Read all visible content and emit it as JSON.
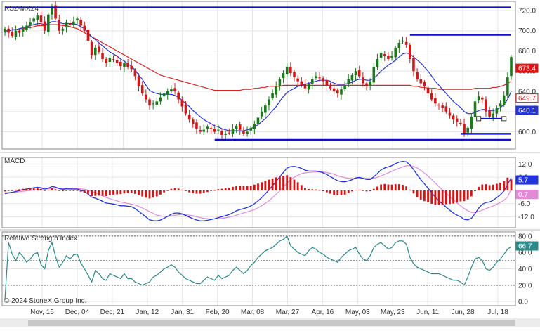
{
  "panels": {
    "price_title": "RS2-MX24",
    "macd_title": "MACD",
    "rsi_title": "Relative Strength Index",
    "copyright": "© 2024 StoneX Group Inc."
  },
  "colors": {
    "candle_up": "#1a7a1a",
    "candle_down": "#d01818",
    "ma_short": "#2233dd",
    "ma_long": "#dd2222",
    "trendline": "#1010cc",
    "macd_line": "#2233dd",
    "signal_line": "#e28ad8",
    "histogram": "#dd1111",
    "rsi_line": "#2a8a8a",
    "label_last": "#dd1111",
    "label_ma_long": "#dd1111",
    "label_ma_short": "#2233dd"
  },
  "chart_data": [
    {
      "type": "candlestick",
      "title": "RS2-MX24",
      "x_tick_labels": [
        "Nov, 15",
        "Dec, 04",
        "Dec, 21",
        "Jan, 12",
        "Jan, 31",
        "Feb, 20",
        "Mar, 08",
        "Mar, 27",
        "Apr, 16",
        "May, 03",
        "May, 23",
        "Jun, 11",
        "Jun, 28",
        "Jul, 18"
      ],
      "ylim": [
        583,
        729
      ],
      "y_ticks": [
        600,
        620,
        640,
        660,
        680,
        700,
        720
      ],
      "grid": true,
      "price_labels": {
        "last": "673.4",
        "ma_long": "649.7",
        "ma_short": "640.1"
      },
      "close": [
        702,
        698,
        695,
        700,
        698,
        702,
        705,
        708,
        712,
        715,
        708,
        700,
        716,
        724,
        712,
        700,
        702,
        708,
        706,
        709,
        712,
        705,
        700,
        690,
        676,
        683,
        679,
        672,
        668,
        673,
        671,
        668,
        665,
        668,
        664,
        662,
        655,
        645,
        638,
        632,
        626,
        628,
        630,
        634,
        638,
        640,
        642,
        640,
        632,
        625,
        618,
        612,
        608,
        603,
        600,
        602,
        605,
        603,
        600,
        602,
        597,
        598,
        599,
        603,
        606,
        602,
        598,
        600,
        604,
        608,
        614,
        620,
        626,
        632,
        638,
        645,
        652,
        658,
        664,
        658,
        654,
        650,
        646,
        643,
        647,
        652,
        655,
        653,
        650,
        646,
        643,
        640,
        638,
        642,
        646,
        652,
        656,
        660,
        655,
        648,
        645,
        650,
        664,
        672,
        678,
        675,
        672,
        675,
        683,
        688,
        690,
        686,
        672,
        660,
        652,
        648,
        645,
        638,
        632,
        628,
        626,
        624,
        620,
        616,
        612,
        610,
        608,
        598,
        604,
        615,
        630,
        635,
        632,
        620,
        615,
        618,
        624,
        628,
        636,
        654,
        674
      ],
      "ma_short": [
        698,
        700,
        701,
        701,
        702,
        703,
        704,
        705,
        706,
        707,
        707,
        706,
        707,
        709,
        709,
        708,
        707,
        707,
        707,
        707,
        706,
        704,
        702,
        698,
        694,
        691,
        688,
        685,
        682,
        679,
        677,
        675,
        672,
        670,
        667,
        665,
        661,
        656,
        652,
        646,
        641,
        639,
        638,
        637,
        637,
        637,
        637,
        636,
        634,
        631,
        628,
        625,
        621,
        618,
        615,
        612,
        610,
        608,
        606,
        605,
        603,
        602,
        601,
        601,
        601,
        601,
        601,
        602,
        603,
        605,
        607,
        610,
        613,
        617,
        621,
        625,
        630,
        635,
        639,
        641,
        643,
        645,
        646,
        647,
        648,
        649,
        650,
        651,
        651,
        651,
        650,
        648,
        647,
        647,
        647,
        648,
        649,
        651,
        652,
        652,
        651,
        651,
        653,
        656,
        660,
        663,
        666,
        668,
        671,
        674,
        677,
        678,
        677,
        674,
        671,
        668,
        664,
        660,
        655,
        650,
        646,
        642,
        638,
        634,
        630,
        627,
        624,
        620,
        618,
        618,
        619,
        621,
        622,
        622,
        621,
        621,
        622,
        624,
        627,
        632,
        640
      ],
      "ma_long": [
        700,
        700,
        701,
        701,
        702,
        702,
        703,
        703,
        704,
        705,
        705,
        705,
        706,
        706,
        706,
        706,
        705,
        705,
        704,
        703,
        702,
        700,
        698,
        696,
        694,
        692,
        690,
        688,
        686,
        684,
        682,
        680,
        678,
        676,
        674,
        672,
        670,
        668,
        666,
        664,
        662,
        660,
        658,
        656,
        655,
        654,
        653,
        652,
        651,
        650,
        649,
        648,
        647,
        646,
        645,
        644,
        643,
        642,
        641,
        641,
        641,
        641,
        641,
        641,
        641,
        641,
        642,
        642,
        642,
        643,
        643,
        644,
        644,
        645,
        645,
        645,
        645,
        646,
        646,
        646,
        646,
        646,
        646,
        646,
        646,
        646,
        646,
        646,
        646,
        646,
        646,
        646,
        646,
        646,
        646,
        646,
        646,
        646,
        646,
        646,
        646,
        646,
        646,
        646,
        646,
        646,
        646,
        646,
        646,
        646,
        646,
        646,
        646,
        645,
        645,
        644,
        644,
        643,
        643,
        643,
        642,
        642,
        642,
        642,
        642,
        642,
        642,
        642,
        642,
        642,
        643,
        643,
        643,
        643,
        643,
        644,
        644,
        645,
        646,
        648,
        650
      ],
      "trendlines": [
        {
          "x": [
            0,
            140
          ],
          "y": [
            723,
            723
          ]
        },
        {
          "x": [
            112,
            140
          ],
          "y": [
            696,
            696
          ]
        },
        {
          "x": [
            58,
            140
          ],
          "y": [
            592,
            592
          ]
        },
        {
          "x": [
            126,
            140
          ],
          "y": [
            598,
            598
          ]
        },
        {
          "x": [
            131,
            138
          ],
          "y": [
            613,
            613
          ]
        }
      ]
    },
    {
      "type": "line",
      "title": "MACD",
      "ylim": [
        -17,
        15
      ],
      "y_ticks": [
        12.0,
        6.0,
        -6.0,
        -12.0
      ],
      "grid": true,
      "value_labels": {
        "macd": "5.7",
        "signal": "0.7"
      },
      "macd": [
        -1.5,
        -1.2,
        -0.9,
        -0.5,
        -0.1,
        0.3,
        0.6,
        0.9,
        1.2,
        1.4,
        1.2,
        0.6,
        1.0,
        1.8,
        1.5,
        0.8,
        0.5,
        0.7,
        0.6,
        0.6,
        0.6,
        0.1,
        -0.5,
        -1.6,
        -3.1,
        -3.6,
        -4.2,
        -5.0,
        -5.8,
        -6.0,
        -6.2,
        -6.6,
        -7.0,
        -7.0,
        -7.2,
        -7.4,
        -8.3,
        -9.5,
        -10.8,
        -12.1,
        -13.4,
        -13.8,
        -13.9,
        -13.5,
        -12.7,
        -11.8,
        -10.9,
        -10.3,
        -10.3,
        -10.7,
        -11.4,
        -12.2,
        -12.9,
        -13.5,
        -13.9,
        -13.9,
        -13.6,
        -13.3,
        -12.9,
        -12.4,
        -12.0,
        -11.5,
        -11.0,
        -10.2,
        -9.3,
        -8.7,
        -8.3,
        -7.8,
        -7.1,
        -6.1,
        -4.8,
        -3.3,
        -1.6,
        0.2,
        2.1,
        4.1,
        6.2,
        8.2,
        10.2,
        10.8,
        10.9,
        10.6,
        10.0,
        9.2,
        8.8,
        8.8,
        8.8,
        8.5,
        8.0,
        7.2,
        6.3,
        5.3,
        4.4,
        4.0,
        3.9,
        4.3,
        4.9,
        5.7,
        5.9,
        5.5,
        5.0,
        5.0,
        6.2,
        7.7,
        9.3,
        10.2,
        10.7,
        11.3,
        12.2,
        12.9,
        13.2,
        13.0,
        11.6,
        9.5,
        7.1,
        4.9,
        3.0,
        1.0,
        -1.1,
        -3.1,
        -4.8,
        -6.2,
        -7.6,
        -9.0,
        -10.3,
        -11.3,
        -12.0,
        -13.2,
        -13.4,
        -12.7,
        -10.5,
        -8.1,
        -6.3,
        -5.5,
        -5.3,
        -4.5,
        -3.3,
        -2.0,
        -0.3,
        2.8,
        5.7
      ],
      "signal": [
        -1.0,
        -1.0,
        -0.9,
        -0.8,
        -0.6,
        -0.4,
        -0.2,
        0.0,
        0.2,
        0.4,
        0.6,
        0.6,
        0.7,
        0.9,
        1.0,
        1.0,
        0.9,
        0.9,
        0.8,
        0.8,
        0.8,
        0.7,
        0.5,
        0.1,
        -0.5,
        -1.1,
        -1.8,
        -2.5,
        -3.2,
        -3.8,
        -4.3,
        -4.8,
        -5.3,
        -5.6,
        -6.0,
        -6.3,
        -6.7,
        -7.3,
        -8.0,
        -8.8,
        -9.7,
        -10.5,
        -11.2,
        -11.6,
        -11.8,
        -11.8,
        -11.6,
        -11.3,
        -11.1,
        -11.0,
        -11.1,
        -11.3,
        -11.6,
        -12.0,
        -12.4,
        -12.7,
        -12.9,
        -13.0,
        -13.0,
        -12.9,
        -12.7,
        -12.5,
        -12.2,
        -11.8,
        -11.3,
        -10.8,
        -10.3,
        -9.8,
        -9.3,
        -8.7,
        -7.9,
        -7.0,
        -5.9,
        -4.7,
        -3.3,
        -1.8,
        -0.2,
        1.5,
        3.3,
        4.8,
        6.0,
        6.9,
        7.6,
        8.0,
        8.2,
        8.3,
        8.4,
        8.4,
        8.4,
        8.1,
        7.8,
        7.3,
        6.7,
        6.2,
        5.8,
        5.5,
        5.4,
        5.5,
        5.6,
        5.6,
        5.5,
        5.4,
        5.5,
        6.0,
        6.6,
        7.3,
        8.0,
        8.7,
        9.4,
        10.1,
        10.7,
        11.2,
        11.3,
        10.9,
        10.2,
        9.1,
        7.9,
        6.5,
        5.0,
        3.4,
        1.8,
        0.2,
        -1.3,
        -2.8,
        -4.3,
        -5.7,
        -7.0,
        -8.3,
        -9.3,
        -10.0,
        -10.1,
        -9.7,
        -9.0,
        -8.3,
        -7.7,
        -7.1,
        -6.3,
        -5.5,
        -4.5,
        -3.0,
        0.7
      ]
    },
    {
      "type": "line",
      "title": "Relative Strength Index",
      "ylim": [
        -5,
        85
      ],
      "y_ticks": [
        80.0,
        60.0,
        40.0,
        20.0,
        0.0
      ],
      "reference_lines": [
        80,
        50,
        20
      ],
      "value_label": "66.7",
      "rsi": [
        2,
        72,
        58,
        50,
        60,
        55,
        48,
        52,
        58,
        60,
        45,
        40,
        62,
        72,
        55,
        42,
        48,
        56,
        52,
        57,
        58,
        47,
        40,
        32,
        24,
        38,
        34,
        28,
        26,
        34,
        32,
        30,
        28,
        34,
        28,
        28,
        24,
        22,
        20,
        22,
        24,
        30,
        32,
        36,
        40,
        42,
        45,
        42,
        36,
        32,
        28,
        26,
        24,
        22,
        22,
        26,
        30,
        28,
        26,
        32,
        28,
        30,
        32,
        38,
        42,
        38,
        34,
        38,
        44,
        48,
        54,
        58,
        62,
        64,
        66,
        70,
        74,
        76,
        80,
        68,
        64,
        60,
        58,
        56,
        62,
        66,
        64,
        60,
        58,
        54,
        52,
        50,
        48,
        54,
        58,
        62,
        64,
        66,
        58,
        52,
        50,
        56,
        66,
        70,
        72,
        68,
        64,
        66,
        72,
        74,
        74,
        70,
        54,
        46,
        42,
        40,
        38,
        36,
        34,
        34,
        34,
        32,
        30,
        28,
        26,
        26,
        24,
        20,
        30,
        42,
        52,
        54,
        50,
        40,
        38,
        42,
        48,
        52,
        58,
        64,
        67
      ]
    }
  ]
}
